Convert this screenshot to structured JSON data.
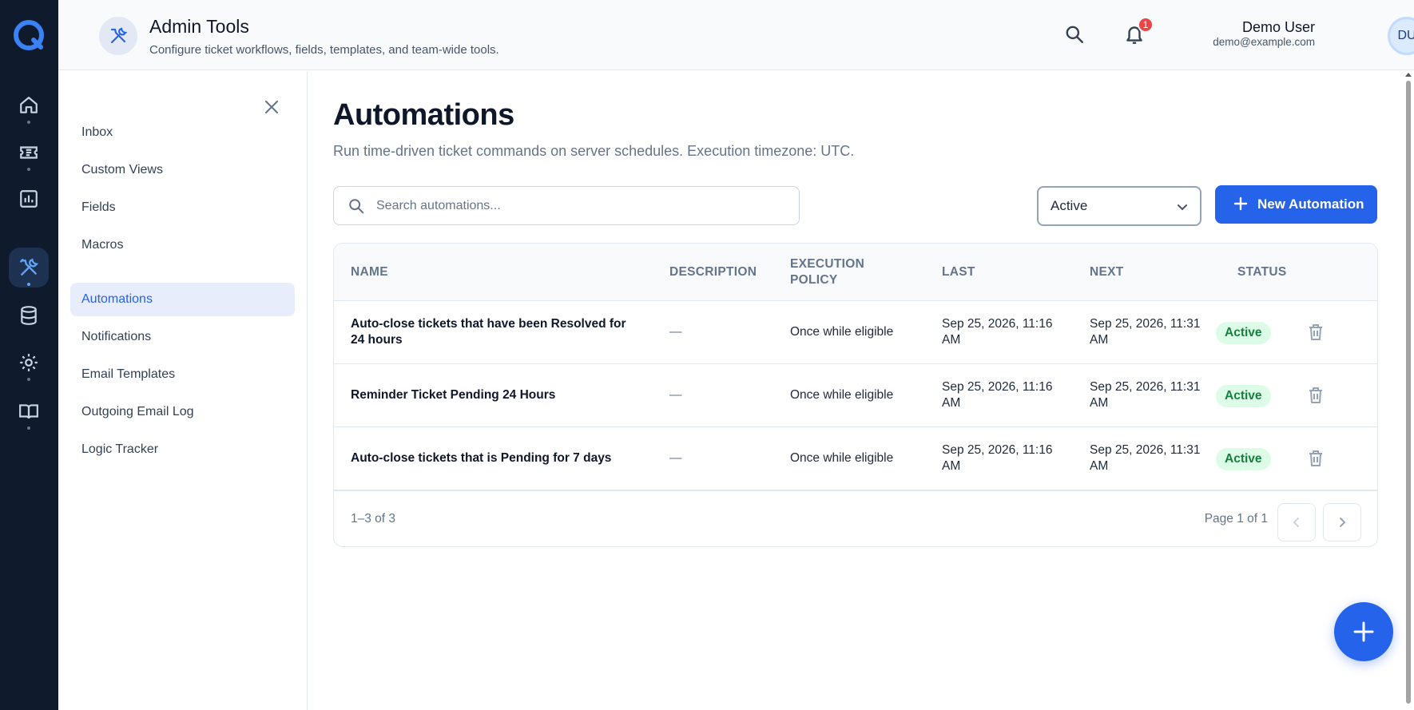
{
  "app": {
    "title": "Admin Tools",
    "subtitle": "Configure ticket workflows, fields, templates, and team-wide tools."
  },
  "rail": {
    "items": [
      {
        "icon": "home-icon",
        "active": false
      },
      {
        "icon": "ticket-icon",
        "active": false
      },
      {
        "icon": "chart-icon",
        "active": false
      },
      {
        "icon": "tools-icon",
        "active": true
      },
      {
        "icon": "database-icon",
        "active": false
      },
      {
        "icon": "gear-icon",
        "active": false
      },
      {
        "icon": "book-icon",
        "active": false
      }
    ]
  },
  "header": {
    "notification_count": "1",
    "user": {
      "name": "Demo User",
      "email": "demo@example.com",
      "initials": "DU"
    }
  },
  "subnav": {
    "items": [
      {
        "label": "Inbox"
      },
      {
        "label": "Custom Views"
      },
      {
        "label": "Fields"
      },
      {
        "label": "Macros"
      },
      {
        "label": "Automations",
        "active": true
      },
      {
        "label": "Notifications"
      },
      {
        "label": "Email Templates"
      },
      {
        "label": "Outgoing Email Log"
      },
      {
        "label": "Logic Tracker"
      }
    ]
  },
  "main": {
    "title": "Automations",
    "description": "Run time-driven ticket commands on server schedules. Execution timezone: UTC.",
    "search_placeholder": "Search automations...",
    "filter_value": "Active",
    "new_button_label": "New Automation",
    "table": {
      "columns": {
        "name": "NAME",
        "description": "DESCRIPTION",
        "execution_policy_1": "EXECUTION",
        "execution_policy_2": "POLICY",
        "last": "LAST",
        "next": "NEXT",
        "status": "STATUS"
      },
      "rows": [
        {
          "name": "Auto-close tickets that have been Resolved for 24 hours",
          "description": "—",
          "policy": "Once while eligible",
          "last_1": "Sep 25, 2026, 11:16",
          "last_2": "AM",
          "next_1": "Sep 25, 2026, 11:31",
          "next_2": "AM",
          "status": "Active"
        },
        {
          "name": "Reminder Ticket Pending 24 Hours",
          "description": "—",
          "policy": "Once while eligible",
          "last_1": "Sep 25, 2026, 11:16",
          "last_2": "AM",
          "next_1": "Sep 25, 2026, 11:31",
          "next_2": "AM",
          "status": "Active"
        },
        {
          "name": "Auto-close tickets that is Pending for 7 days",
          "description": "—",
          "policy": "Once while eligible",
          "last_1": "Sep 25, 2026, 11:16",
          "last_2": "AM",
          "next_1": "Sep 25, 2026, 11:31",
          "next_2": "AM",
          "status": "Active"
        }
      ],
      "footer": {
        "count": "1–3 of 3",
        "page_info": "Page 1 of 1"
      }
    }
  },
  "colors": {
    "rail_bg": "#0f1b2d",
    "accent": "#2563eb",
    "status_active_bg": "#dcfce7",
    "status_active_text": "#15803d",
    "badge": "#ef4444"
  }
}
